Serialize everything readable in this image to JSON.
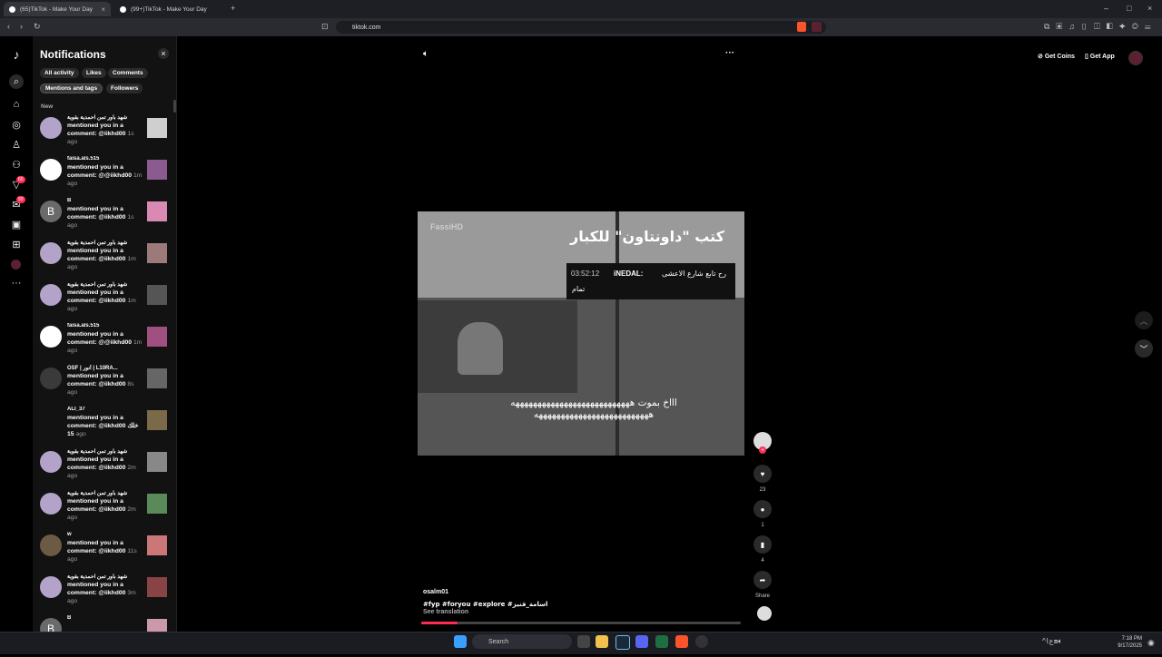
{
  "browser": {
    "tabs": [
      {
        "title": "(65)TikTok - Make Your Day",
        "active": true
      },
      {
        "title": "(99+)TikTok - Make Your Day",
        "active": false
      }
    ],
    "url": "tiktok.com"
  },
  "notifications": {
    "title": "Notifications",
    "filters": [
      "All activity",
      "Likes",
      "Comments",
      "Mentions and tags",
      "Followers"
    ],
    "active_filter": "Mentions and tags",
    "section": "New",
    "items": [
      {
        "name": "شهد باور تمن احمدية بقوية",
        "text": "mentioned you in a comment: @iikhd00",
        "time": "1s ago",
        "avatar": "#b3a3c9",
        "initial": ""
      },
      {
        "name": "faisa.als.515",
        "text": "mentioned you in a comment: @@iikhd00",
        "time": "1m ago",
        "avatar": "#ffffff",
        "initial": ""
      },
      {
        "name": "B",
        "text": "mentioned you in a comment: @iikhd00",
        "time": "1s ago",
        "avatar": "#6a6a6a",
        "initial": "B"
      },
      {
        "name": "شهد باور تمن احمدية بقوية",
        "text": "mentioned you in a comment: @iikhd00",
        "time": "1m ago",
        "avatar": "#b3a3c9",
        "initial": ""
      },
      {
        "name": "شهد باور تمن احمدية بقوية",
        "text": "mentioned you in a comment: @iikhd00",
        "time": "1m ago",
        "avatar": "#b3a3c9",
        "initial": ""
      },
      {
        "name": "faisa.als.515",
        "text": "mentioned you in a comment: @@iikhd00",
        "time": "1m ago",
        "avatar": "#ffffff",
        "initial": ""
      },
      {
        "name": "OSF | أنور | L10RA...",
        "text": "mentioned you in a comment: @iikhd00",
        "time": "8s ago",
        "avatar": "#3a3a3a",
        "initial": ""
      },
      {
        "name": "ALI_37",
        "text": "mentioned you in a comment: @iikhd00 خلك 15",
        "time": "ago",
        "avatar": "#121212",
        "initial": ""
      },
      {
        "name": "شهد باور تمن احمدية بقوية",
        "text": "mentioned you in a comment: @iikhd00",
        "time": "2m ago",
        "avatar": "#b3a3c9",
        "initial": ""
      },
      {
        "name": "شهد باور تمن احمدية بقوية",
        "text": "mentioned you in a comment: @iikhd00",
        "time": "2m ago",
        "avatar": "#b3a3c9",
        "initial": ""
      },
      {
        "name": "w",
        "text": "mentioned you in a comment: @iikhd00",
        "time": "11s ago",
        "avatar": "#6b5a44",
        "initial": ""
      },
      {
        "name": "شهد باور تمن احمدية بقوية",
        "text": "mentioned you in a comment: @iikhd00",
        "time": "3m ago",
        "avatar": "#b3a3c9",
        "initial": ""
      },
      {
        "name": "B",
        "text": "",
        "time": "",
        "avatar": "#6a6a6a",
        "initial": "B"
      }
    ]
  },
  "header": {
    "get_coins": "Get Coins",
    "get_app": "Get App"
  },
  "video": {
    "title": "كتب \"داونتاون\" للكبار",
    "watermark": "FassiHD",
    "chat_user": "iNEDAL:",
    "chat_time": "03:52:12",
    "chat_line1": "رح تابع شارع الاعشى",
    "chat_line2": "تمام",
    "subtitle": "اااخ بموت هههههههههههههههههههههههههههه ههههههههههههههههههههههههههه",
    "author": "osalm01",
    "caption": "#fyp #foryou #explore #اسامة_قنيز",
    "see_translation": "See translation"
  },
  "actions": {
    "likes": "23",
    "comments": "1",
    "saves": "4",
    "share": "Share"
  },
  "taskbar": {
    "search": "Search",
    "time": "7:18 PM",
    "date": "9/17/2025"
  }
}
